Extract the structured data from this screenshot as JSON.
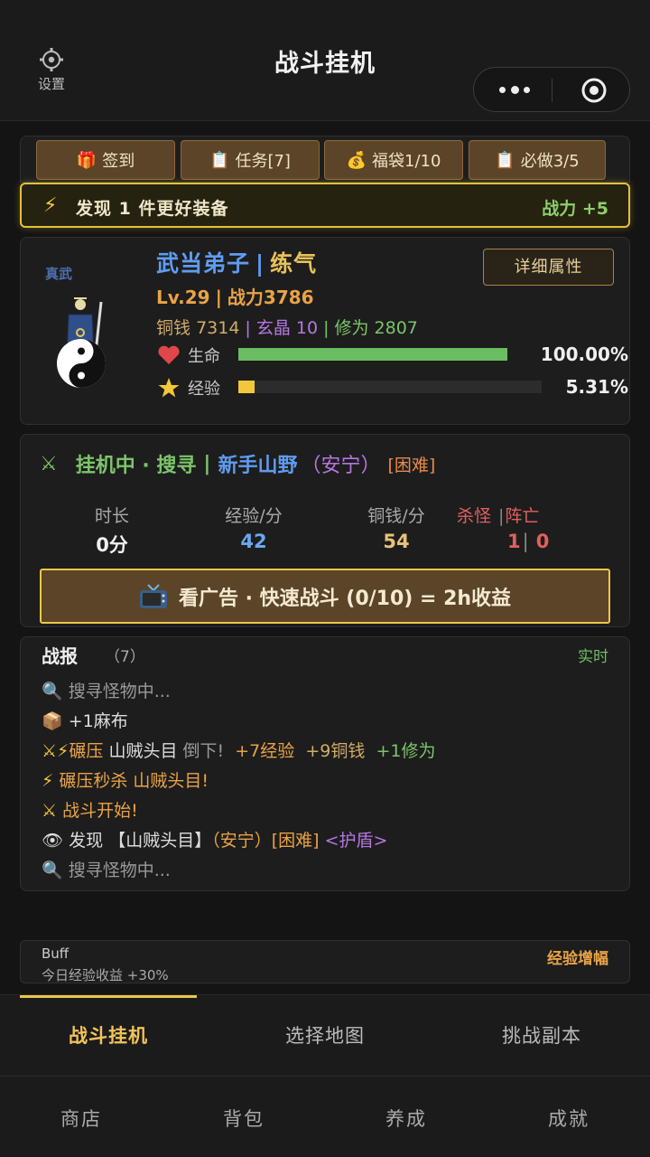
{
  "header": {
    "title": "战斗挂机",
    "settings_label": "设置"
  },
  "quick_buttons": [
    {
      "icon": "🎁",
      "label": "签到"
    },
    {
      "icon": "📋",
      "label": "任务[7]"
    },
    {
      "icon": "💰",
      "label": "福袋1/10"
    },
    {
      "icon": "📋",
      "label": "必做3/5"
    }
  ],
  "banner": {
    "text": "发现 1 件更好装备",
    "power": "战力 +5"
  },
  "character": {
    "avatar_name": "真武",
    "sect": "武当弟子",
    "realm": "练气",
    "level": "Lv.29",
    "power": "战力3786",
    "copper_label": "铜钱",
    "copper": "7314",
    "crystal_label": "玄晶",
    "crystal": "10",
    "cultivation_label": "修为",
    "cultivation": "2807",
    "detail_button": "详细属性",
    "hp_label": "生命",
    "hp_percent": "100.00%",
    "hp_fraction": 1.0,
    "exp_label": "经验",
    "exp_percent": "5.31%",
    "exp_fraction": 0.0531
  },
  "idle": {
    "status": "挂机中 · 搜寻",
    "map": "新手山野",
    "zone": "（安宁）",
    "difficulty": "[困难]",
    "columns": {
      "duration_label": "时长",
      "duration": "0分",
      "exp_label": "经验/分",
      "exp": "42",
      "copper_label": "铜钱/分",
      "copper": "54",
      "kills_label": "杀怪",
      "deaths_label": "阵亡",
      "kills": "1",
      "deaths": "0"
    },
    "ad_button": "看广告 · 快速战斗 (0/10) = 2h收益"
  },
  "battle_log": {
    "title": "战报",
    "count": "（7）",
    "live": "实时",
    "l1": "搜寻怪物中...",
    "l2": "+1麻布",
    "l3_a": "碾压",
    "l3_b": "山贼头目",
    "l3_c": "倒下!",
    "l3_d": "+7经验",
    "l3_e": "+9铜钱",
    "l3_f": "+1修为",
    "l4": "碾压秒杀 山贼头目!",
    "l5": "战斗开始!",
    "l6_a": "发现",
    "l6_b": "【山贼头目】",
    "l6_c": "（安宁）[困难]",
    "l6_d": "<护盾>",
    "l7": "搜寻怪物中..."
  },
  "buff": {
    "title": "Buff",
    "desc": "今日经验收益 +30%",
    "tag": "经验增幅"
  },
  "tabs": [
    "战斗挂机",
    "选择地图",
    "挑战副本"
  ],
  "bottom_nav": [
    "商店",
    "背包",
    "养成",
    "成就"
  ]
}
